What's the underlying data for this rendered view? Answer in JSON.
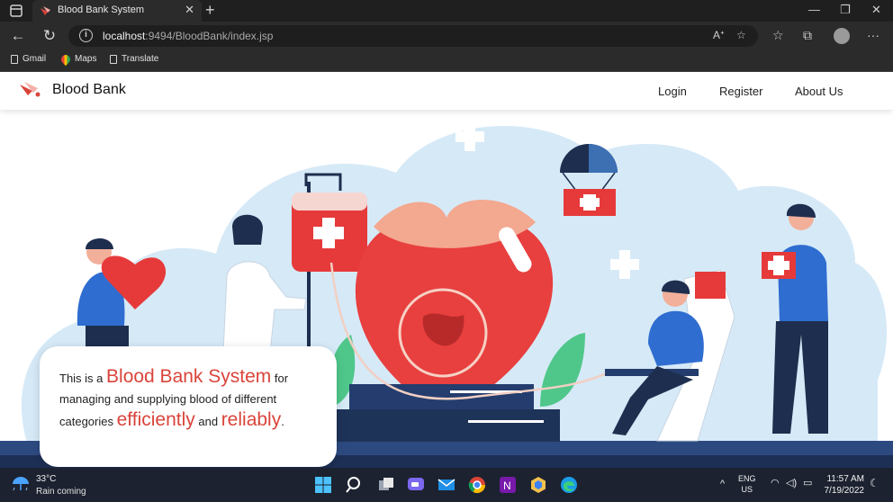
{
  "browser": {
    "tab_title": "Blood Bank System",
    "url_host": "localhost",
    "url_rest": ":9494/BloodBank/index.jsp",
    "bookmarks": [
      "Gmail",
      "Maps",
      "Translate"
    ]
  },
  "site": {
    "brand": "Blood Bank",
    "nav": [
      "Login",
      "Register",
      "About Us"
    ]
  },
  "hero": {
    "text_1": "This is a ",
    "highlight_1": "Blood Bank System",
    "text_2": " for managing and supplying blood of different categories ",
    "highlight_2": "efficiently",
    "text_3": " and ",
    "highlight_3": "reliably",
    "text_4": "."
  },
  "taskbar": {
    "temperature": "33°C",
    "weather": "Rain coming",
    "lang_1": "ENG",
    "lang_2": "US",
    "time": "11:57 AM",
    "date": "7/19/2022"
  },
  "colors": {
    "accent_red": "#d9443a",
    "sky": "#dcecf7",
    "navy": "#2a3f6b"
  }
}
